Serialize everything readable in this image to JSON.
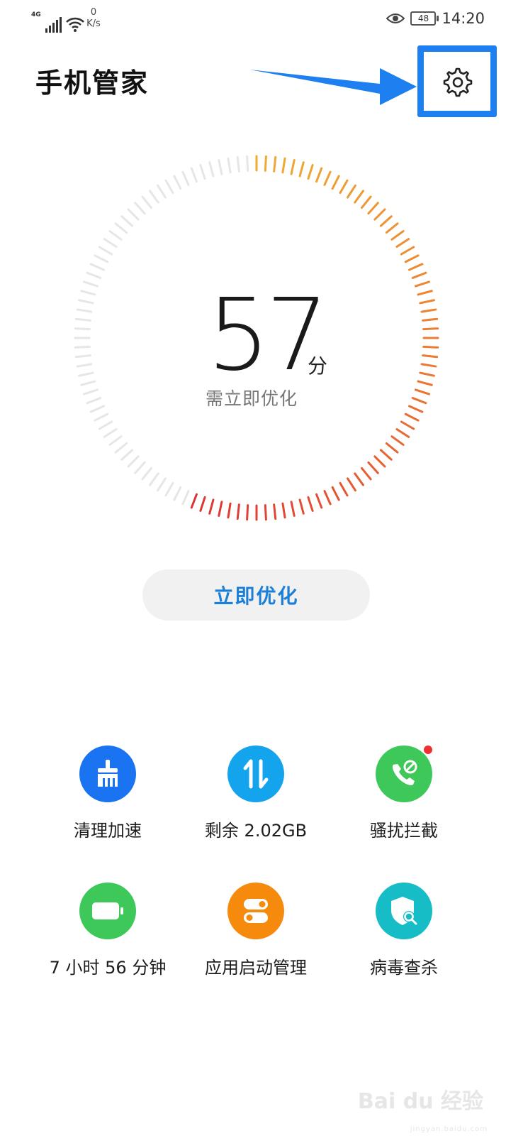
{
  "status_bar": {
    "network_type": "4G",
    "speed_value": "0",
    "speed_unit": "K/s",
    "battery_level": "48",
    "time": "14:20",
    "icons": [
      "signal-icon",
      "wifi-icon",
      "eye-icon",
      "battery-icon"
    ]
  },
  "header": {
    "title": "手机管家",
    "settings_icon": "gear-icon"
  },
  "score": {
    "value": "57",
    "unit": "分",
    "caption": "需立即优化",
    "max": 100
  },
  "colors": {
    "accent": "#1b7fd8",
    "highlight_box": "#1e7ff0",
    "gauge_empty": "#e6e6e6"
  },
  "optimize_button": {
    "label": "立即优化"
  },
  "features": [
    {
      "label": "清理加速",
      "icon": "broom-icon",
      "color": "#1a73f0"
    },
    {
      "label": "剩余 2.02GB",
      "icon": "data-transfer-icon",
      "color": "#14a4ee"
    },
    {
      "label": "骚扰拦截",
      "icon": "phone-block-icon",
      "color": "#3ec85a",
      "badge": true
    },
    {
      "label": "7 小时 56 分钟",
      "icon": "battery-icon",
      "color": "#3ec85a"
    },
    {
      "label": "应用启动管理",
      "icon": "toggle-icon",
      "color": "#f58a0c"
    },
    {
      "label": "病毒查杀",
      "icon": "shield-search-icon",
      "color": "#16bcc6"
    }
  ],
  "watermark": {
    "text": "Bai du 经验",
    "url": "jingyan.baidu.com"
  }
}
